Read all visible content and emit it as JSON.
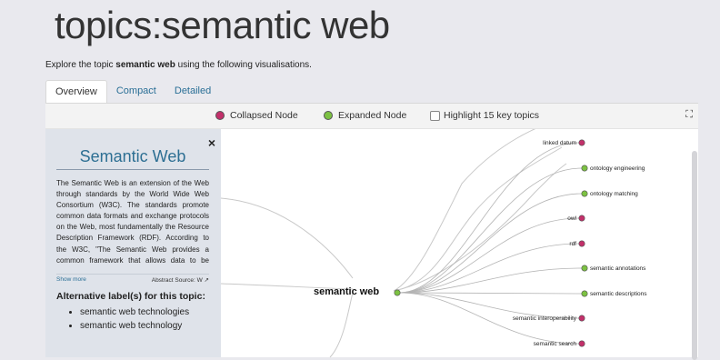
{
  "page": {
    "title": "topics:semantic web",
    "intro_before": "Explore the topic ",
    "intro_bold": "semantic web",
    "intro_after": " using the following visualisations."
  },
  "tabs": [
    {
      "label": "Overview",
      "active": true
    },
    {
      "label": "Compact",
      "active": false
    },
    {
      "label": "Detailed",
      "active": false
    }
  ],
  "legend": {
    "collapsed": "Collapsed Node",
    "expanded": "Expanded Node",
    "highlight": "Highlight 15 key topics",
    "collapsed_color": "#c2306a",
    "expanded_color": "#7cc142"
  },
  "sidebar": {
    "close": "×",
    "title": "Semantic Web",
    "abstract": "The Semantic Web is an extension of the Web through standards by the World Wide Web Consortium (W3C). The standards promote common data formats and exchange protocols on the Web, most fundamentally the Resource Description Framework (RDF). According to the W3C, \"The Semantic Web provides a common framework that allows data to be shared and reused across application, enterprise, and community boundaries.\"",
    "show_more": "Show more",
    "abstract_source": "Abstract Source: W",
    "alt_heading": "Alternative label(s) for this topic:",
    "alt_labels": [
      "semantic web technologies",
      "semantic web technology"
    ]
  },
  "graph": {
    "root": "semantic web",
    "children": [
      {
        "label": "linked datum",
        "state": "collapsed"
      },
      {
        "label": "ontology engineering",
        "state": "expanded"
      },
      {
        "label": "ontology matching",
        "state": "expanded"
      },
      {
        "label": "owl",
        "state": "collapsed"
      },
      {
        "label": "rdf",
        "state": "collapsed"
      },
      {
        "label": "semantic annotations",
        "state": "expanded"
      },
      {
        "label": "semantic descriptions",
        "state": "expanded"
      },
      {
        "label": "semantic interoperability",
        "state": "collapsed"
      },
      {
        "label": "semantic search",
        "state": "collapsed"
      }
    ]
  }
}
